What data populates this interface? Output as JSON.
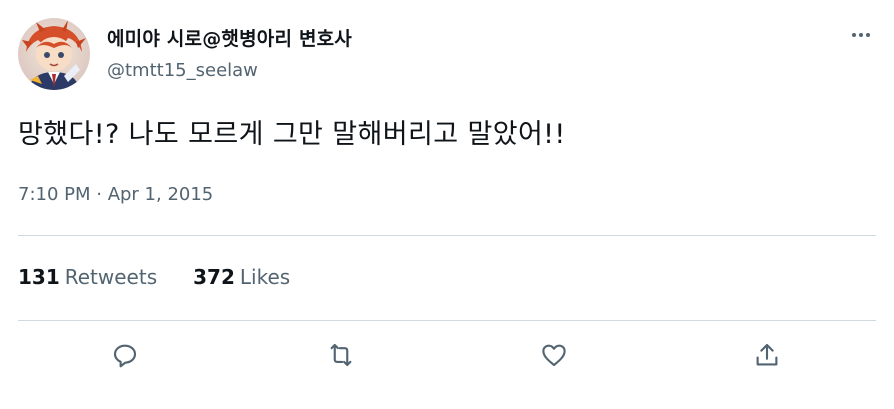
{
  "author": {
    "display_name": "에미야 시로@햇병아리 변호사",
    "handle": "@tmtt15_seelaw"
  },
  "tweet": {
    "text": "망했다!? 나도 모르게 그만 말해버리고 말았어!!",
    "timestamp": "7:10 PM · Apr 1, 2015"
  },
  "stats": {
    "retweets_count": "131",
    "retweets_label": "Retweets",
    "likes_count": "372",
    "likes_label": "Likes"
  },
  "icons": {
    "more": "more-horizontal-icon",
    "reply": "reply-icon",
    "retweet": "retweet-icon",
    "like": "heart-icon",
    "share": "share-icon"
  },
  "colors": {
    "text_primary": "#0f1419",
    "text_secondary": "#536471",
    "divider": "#cfd9de"
  }
}
